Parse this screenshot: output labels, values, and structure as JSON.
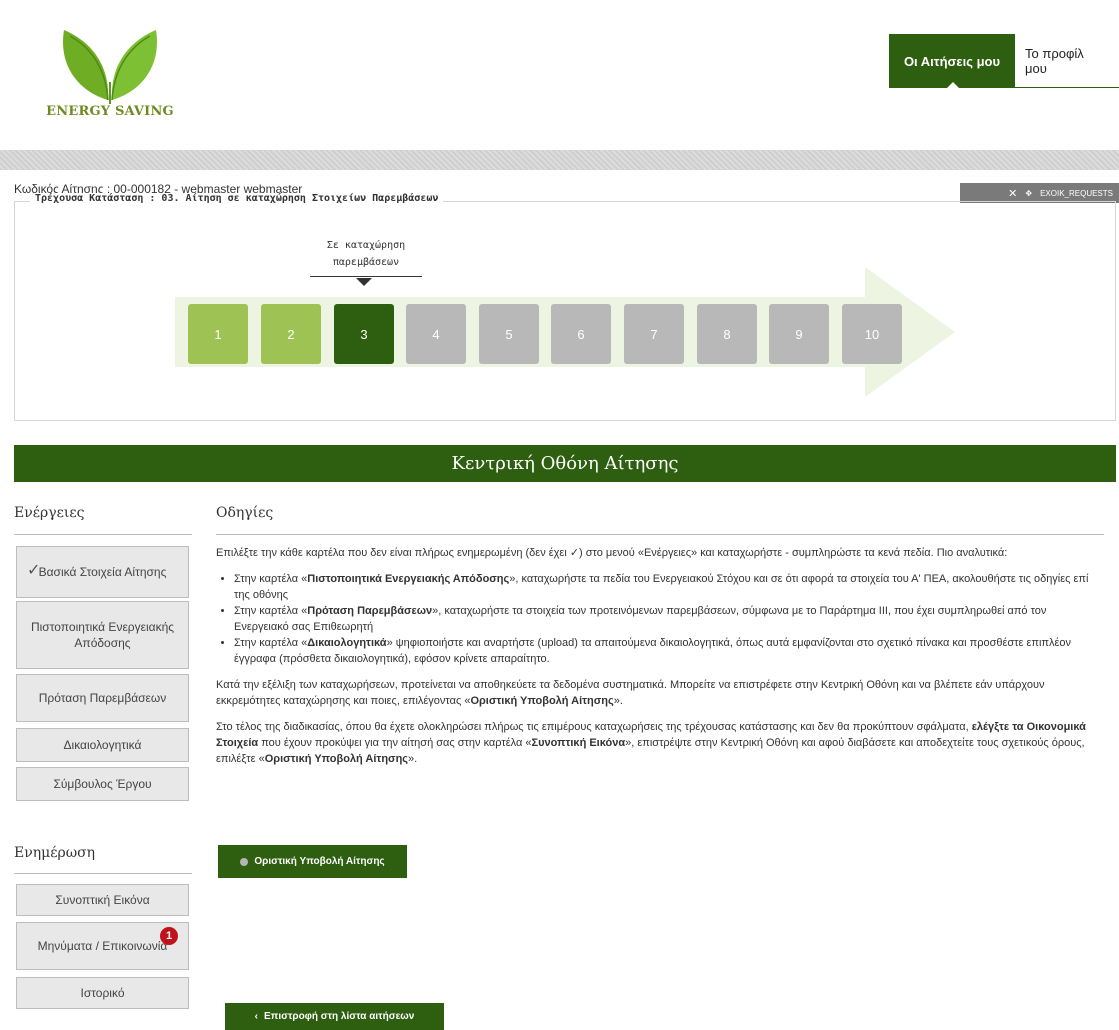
{
  "logo": {
    "text": "ENERGY SAVING"
  },
  "nav": {
    "items": [
      "Οι Αιτήσεις μου",
      "Το προφίλ μου"
    ]
  },
  "request": {
    "code": "Κωδικός Αίτησης : 00-000182 - webmaster webmaster",
    "status": "Τρέχουσα Κατάσταση : 03. Αίτηση σε καταχώρηση Στοιχείων Παρεμβάσεων",
    "exit_label": "EXOIK_REQUESTS"
  },
  "progress": {
    "stage_label_line1": "Σε καταχώρηση",
    "stage_label_line2": "παρεμβάσεων",
    "current_step": 3,
    "steps": [
      "1",
      "2",
      "3",
      "4",
      "5",
      "6",
      "7",
      "8",
      "9",
      "10"
    ]
  },
  "central_title": "Κεντρική Οθόνη Αίτησης",
  "sidebar": {
    "actions_title": "Ενέργειες",
    "actions": [
      "Βασικά Στοιχεία Αίτησης",
      "Πιστοποιητικά Ενεργειακής Απόδοσης",
      "Πρόταση Παρεμβάσεων",
      "Δικαιολογητικά",
      "Σύμβουλος Έργου"
    ],
    "info_title": "Ενημέρωση",
    "info": [
      "Συνοπτική Εικόνα",
      "Μηνύματα / Επικοινωνία",
      "Ιστορικό"
    ],
    "messages_badge": "1"
  },
  "instructions": {
    "title": "Οδηγίες",
    "p1": "Επιλέξτε την κάθε καρτέλα που δεν είναι πλήρως ενημερωμένη (δεν έχει ✓) στο μενού «Ενέργειες» και καταχωρήστε - συμπληρώστε τα κενά πεδία. Πιο αναλυτικά:",
    "b1_pre": "Στην καρτέλα «",
    "b1_bold": "Πιστοποιητικά Ενεργειακής Απόδοσης",
    "b1_post": "», καταχωρήστε τα πεδία του Ενεργειακού Στόχου και σε ότι αφορά τα στοιχεία του Α' ΠΕΑ, ακολουθήστε τις οδηγίες επί της οθόνης",
    "b2_pre": "Στην καρτέλα «",
    "b2_bold": "Πρόταση Παρεμβάσεων",
    "b2_post": "», καταχωρήστε τα στοιχεία των προτεινόμενων παρεμβάσεων, σύμφωνα με το Παράρτημα III, που έχει συμπληρωθεί από τον Ενεργειακό σας Επιθεωρητή",
    "b3_pre": "Στην καρτέλα «",
    "b3_bold": "Δικαιολογητικά",
    "b3_post": "» ψηφιοποιήστε και αναρτήστε (upload) τα απαιτούμενα δικαιολογητικά, όπως αυτά εμφανίζονται στο σχετικό πίνακα και προσθέστε επιπλέον έγγραφα (πρόσθετα δικαιολογητικά), εφόσον κρίνετε απαραίτητο.",
    "p2_pre": "Κατά την εξέλιξη των καταχωρήσεων, προτείνεται να αποθηκεύετε τα δεδομένα συστηματικά. Μπορείτε να επιστρέφετε στην Κεντρική Οθόνη και να βλέπετε εάν υπάρχουν εκκρεμότητες καταχώρησης και ποιες, επιλέγοντας «",
    "p2_bold": "Οριστική Υποβολή Αίτησης",
    "p2_post": "».",
    "p3_pre": "Στο τέλος της διαδικασίας, όπου θα έχετε ολοκληρώσει πλήρως τις επιμέρους καταχωρήσεις της τρέχουσας κατάστασης και δεν θα προκύπτουν σφάλματα, ",
    "p3_bold1": "ελέγξτε τα Οικονομικά Στοιχεία",
    "p3_mid1": " που έχουν προκύψει για την αίτησή σας στην καρτέλα «",
    "p3_bold2": "Συνοπτική Εικόνα",
    "p3_mid2": "», επιστρέψτε στην Κεντρική Οθόνη και αφού διαβάσετε και αποδεχτείτε τους σχετικούς όρους, επιλέξτε «",
    "p3_bold3": "Οριστική Υποβολή Αίτησης",
    "p3_post": "»."
  },
  "buttons": {
    "submit": "Οριστική Υποβολή Αίτησης",
    "back": "Επιστροφή στη λίστα αιτήσεων"
  }
}
